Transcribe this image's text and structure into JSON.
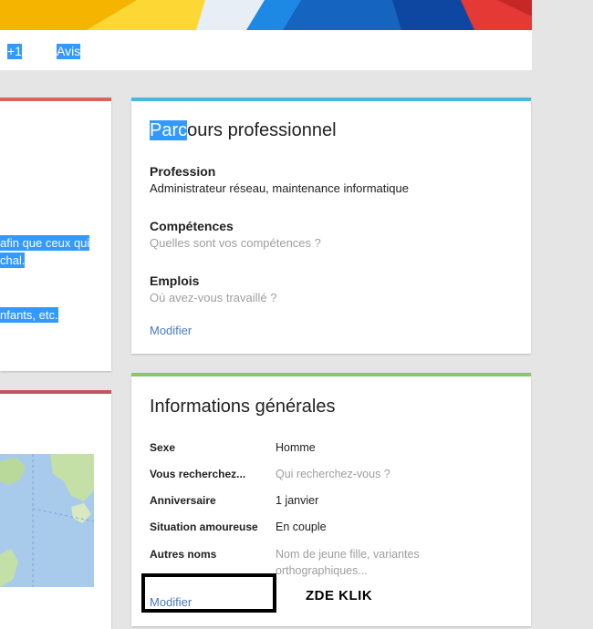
{
  "tabs": {
    "plus1": "+1",
    "avis": "Avis"
  },
  "left_card": {
    "lines": [
      "afin que ceux qui",
      "chal.",
      "nfants, etc."
    ]
  },
  "parcours": {
    "title_selected": "Parc",
    "title_rest": "ours professionnel",
    "profession_label": "Profession",
    "profession_value": "Administrateur réseau, maintenance informatique",
    "competences_label": "Compétences",
    "competences_hint": "Quelles sont vos compétences ?",
    "emplois_label": "Emplois",
    "emplois_hint": "Où avez-vous travaillé ?",
    "modifier": "Modifier"
  },
  "info": {
    "title": "Informations générales",
    "rows": [
      {
        "label": "Sexe",
        "value": "Homme"
      },
      {
        "label": "Vous recherchez...",
        "value": "Qui recherchez-vous ?"
      },
      {
        "label": "Anniversaire",
        "value": "1 janvier"
      },
      {
        "label": "Situation amoureuse",
        "value": "En couple"
      },
      {
        "label": "Autres noms",
        "value_line1": "Nom de jeune fille, variantes",
        "value_line2": "orthographiques..."
      }
    ],
    "modifier": "Modifier"
  },
  "annotation": {
    "text": "ZDE KLIK"
  },
  "colors": {
    "accent_red": "#d4665a",
    "accent_blue": "#4bb8d8",
    "accent_green": "#8dc56f",
    "accent_rose": "#c4555f",
    "link": "#4a78c4",
    "selection": "#3399ff"
  }
}
